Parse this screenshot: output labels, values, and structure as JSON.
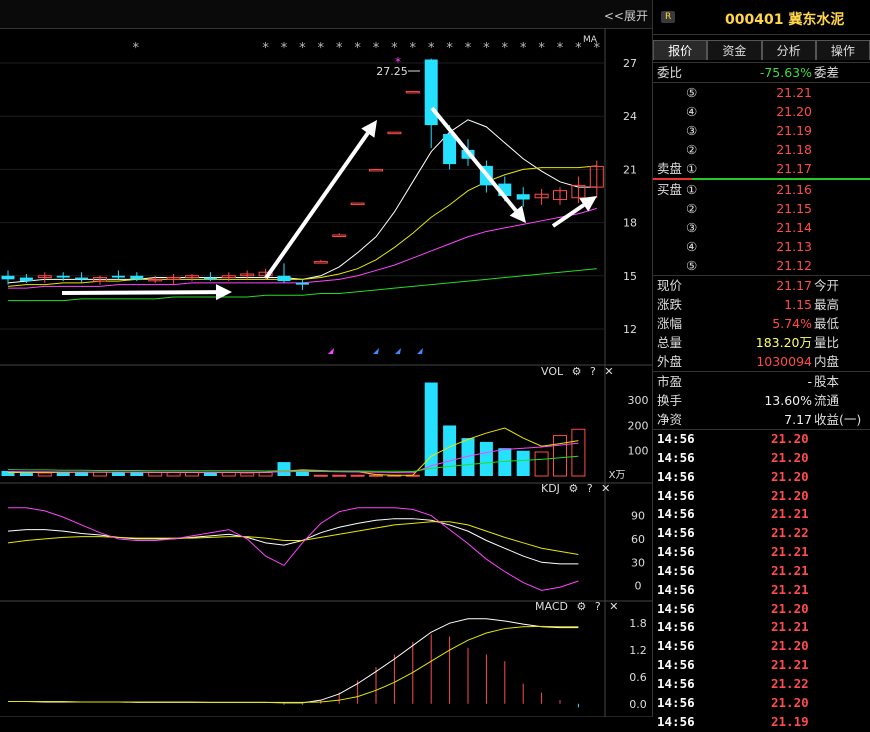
{
  "topbar": {
    "expand_label": "<<展开"
  },
  "chart_data": [
    {
      "type": "candlestick",
      "title": "MA",
      "yticks": [
        27,
        24,
        21,
        18,
        15,
        12
      ],
      "ylim": [
        10.7,
        28.3
      ],
      "peak_label": "27.25",
      "candles": [
        {
          "o": 15.0,
          "h": 15.3,
          "l": 14.5,
          "c": 14.8
        },
        {
          "o": 14.9,
          "h": 15.1,
          "l": 14.6,
          "c": 14.7
        },
        {
          "o": 14.9,
          "h": 15.2,
          "l": 14.6,
          "c": 15.0
        },
        {
          "o": 15.0,
          "h": 15.2,
          "l": 14.7,
          "c": 14.9
        },
        {
          "o": 14.9,
          "h": 15.2,
          "l": 14.6,
          "c": 14.8
        },
        {
          "o": 14.7,
          "h": 15.0,
          "l": 14.5,
          "c": 14.9
        },
        {
          "o": 15.0,
          "h": 15.3,
          "l": 14.8,
          "c": 14.9
        },
        {
          "o": 15.0,
          "h": 15.2,
          "l": 14.7,
          "c": 14.8
        },
        {
          "o": 14.8,
          "h": 15.0,
          "l": 14.6,
          "c": 14.8
        },
        {
          "o": 14.8,
          "h": 15.1,
          "l": 14.5,
          "c": 14.9
        },
        {
          "o": 14.9,
          "h": 15.1,
          "l": 14.7,
          "c": 15.0
        },
        {
          "o": 14.9,
          "h": 15.2,
          "l": 14.7,
          "c": 14.8
        },
        {
          "o": 14.9,
          "h": 15.2,
          "l": 14.7,
          "c": 15.0
        },
        {
          "o": 15.0,
          "h": 15.3,
          "l": 14.8,
          "c": 15.1
        },
        {
          "o": 15.0,
          "h": 15.4,
          "l": 14.8,
          "c": 15.2
        },
        {
          "o": 15.0,
          "h": 15.7,
          "l": 14.6,
          "c": 14.7
        },
        {
          "o": 14.6,
          "h": 14.8,
          "l": 14.2,
          "c": 14.5
        },
        {
          "o": 15.8,
          "h": 15.9,
          "l": 15.8,
          "c": 15.8
        },
        {
          "o": 17.3,
          "h": 17.4,
          "l": 17.3,
          "c": 17.3
        },
        {
          "o": 19.1,
          "h": 19.1,
          "l": 19.1,
          "c": 19.1
        },
        {
          "o": 21.0,
          "h": 21.0,
          "l": 21.0,
          "c": 21.0
        },
        {
          "o": 23.1,
          "h": 23.1,
          "l": 23.1,
          "c": 23.1
        },
        {
          "o": 25.4,
          "h": 25.4,
          "l": 25.4,
          "c": 25.4
        },
        {
          "o": 27.2,
          "h": 27.25,
          "l": 22.2,
          "c": 23.5
        },
        {
          "o": 23.0,
          "h": 23.5,
          "l": 21.0,
          "c": 21.3
        },
        {
          "o": 22.1,
          "h": 22.7,
          "l": 21.2,
          "c": 21.6
        },
        {
          "o": 21.2,
          "h": 21.5,
          "l": 19.7,
          "c": 20.1
        },
        {
          "o": 20.2,
          "h": 20.6,
          "l": 19.2,
          "c": 19.5
        },
        {
          "o": 19.6,
          "h": 20.0,
          "l": 18.9,
          "c": 19.3
        },
        {
          "o": 19.4,
          "h": 19.9,
          "l": 19.0,
          "c": 19.6
        },
        {
          "o": 19.3,
          "h": 20.0,
          "l": 19.0,
          "c": 19.8
        },
        {
          "o": 19.4,
          "h": 20.6,
          "l": 19.1,
          "c": 20.1
        },
        {
          "o": 20.0,
          "h": 21.5,
          "l": 19.4,
          "c": 21.17
        }
      ],
      "ma": [
        {
          "name": "MA5",
          "color": "#ffffff",
          "values": [
            14.6,
            14.7,
            14.8,
            14.8,
            14.8,
            14.8,
            14.8,
            14.8,
            14.9,
            14.9,
            14.9,
            14.9,
            14.9,
            14.9,
            14.9,
            14.9,
            14.8,
            15.0,
            15.5,
            16.3,
            17.2,
            18.6,
            20.3,
            22.0,
            23.1,
            23.8,
            23.4,
            22.5,
            21.6,
            20.9,
            20.3,
            20.0,
            20.0
          ]
        },
        {
          "name": "MA10",
          "color": "#e6e600",
          "values": [
            14.4,
            14.5,
            14.5,
            14.6,
            14.6,
            14.7,
            14.7,
            14.8,
            14.8,
            14.8,
            14.8,
            14.8,
            14.8,
            14.8,
            14.8,
            14.8,
            14.8,
            14.9,
            15.1,
            15.4,
            15.9,
            16.6,
            17.4,
            18.3,
            19.0,
            19.8,
            20.3,
            20.7,
            21.0,
            21.1,
            21.1,
            21.1,
            21.2
          ]
        },
        {
          "name": "MA20",
          "color": "#ff44ff",
          "values": [
            14.3,
            14.3,
            14.4,
            14.4,
            14.4,
            14.4,
            14.5,
            14.5,
            14.5,
            14.5,
            14.6,
            14.6,
            14.6,
            14.6,
            14.6,
            14.6,
            14.6,
            14.7,
            14.8,
            15.0,
            15.3,
            15.6,
            16.0,
            16.4,
            16.8,
            17.2,
            17.5,
            17.7,
            17.9,
            18.1,
            18.3,
            18.5,
            18.8
          ]
        },
        {
          "name": "MA60",
          "color": "#22dd22",
          "values": [
            13.6,
            13.6,
            13.6,
            13.6,
            13.7,
            13.7,
            13.7,
            13.7,
            13.7,
            13.8,
            13.8,
            13.8,
            13.8,
            13.8,
            13.9,
            13.9,
            13.9,
            14.0,
            14.0,
            14.1,
            14.2,
            14.3,
            14.4,
            14.5,
            14.6,
            14.7,
            14.8,
            14.9,
            15.0,
            15.1,
            15.2,
            15.3,
            15.4
          ]
        }
      ]
    },
    {
      "type": "bar",
      "title": "VOL",
      "unit": "X万",
      "yticks": [
        300,
        200,
        100
      ],
      "ylim": [
        0,
        380
      ],
      "values": [
        20,
        14,
        12,
        14,
        16,
        16,
        14,
        14,
        14,
        14,
        14,
        16,
        14,
        12,
        14,
        55,
        22,
        3,
        3,
        3,
        3,
        3,
        3,
        370,
        200,
        150,
        135,
        110,
        100,
        95,
        160,
        185
      ],
      "ma": [
        {
          "name": "MA5",
          "color": "#e6e600",
          "values": [
            14,
            14,
            14,
            14,
            15,
            15,
            15,
            15,
            14,
            14,
            14,
            14,
            14,
            14,
            14,
            20,
            24,
            22,
            18,
            17,
            6,
            3,
            3,
            78,
            115,
            145,
            170,
            190,
            150,
            118,
            128,
            140
          ]
        },
        {
          "name": "MA10",
          "color": "#ff44ff",
          "values": [
            18,
            17,
            17,
            16,
            16,
            16,
            16,
            16,
            15,
            15,
            15,
            15,
            15,
            15,
            15,
            17,
            18,
            18,
            17,
            16,
            15,
            14,
            13,
            40,
            60,
            78,
            93,
            105,
            110,
            115,
            122,
            130
          ]
        },
        {
          "name": "MA20",
          "color": "#22dd22",
          "values": [
            25,
            24,
            24,
            23,
            23,
            22,
            22,
            22,
            21,
            21,
            21,
            21,
            21,
            21,
            20,
            21,
            21,
            21,
            20,
            20,
            19,
            19,
            18,
            30,
            38,
            45,
            52,
            58,
            62,
            66,
            72,
            78
          ]
        }
      ]
    },
    {
      "type": "line",
      "title": "KDJ",
      "yticks": [
        90,
        60,
        30,
        0
      ],
      "ylim": [
        -12,
        110
      ],
      "series": [
        {
          "name": "K",
          "color": "#ffffff",
          "values": [
            70,
            72,
            72,
            70,
            67,
            65,
            62,
            60,
            60,
            60,
            62,
            64,
            66,
            62,
            55,
            52,
            58,
            68,
            75,
            80,
            84,
            86,
            86,
            84,
            78,
            70,
            58,
            48,
            38,
            30,
            28,
            28
          ]
        },
        {
          "name": "D",
          "color": "#e6e600",
          "values": [
            55,
            58,
            60,
            62,
            63,
            63,
            62,
            61,
            61,
            61,
            61,
            62,
            63,
            63,
            61,
            58,
            58,
            62,
            66,
            70,
            74,
            78,
            80,
            82,
            82,
            78,
            70,
            62,
            55,
            48,
            44,
            40
          ]
        },
        {
          "name": "J",
          "color": "#ff44ff",
          "values": [
            100,
            100,
            96,
            88,
            78,
            68,
            60,
            58,
            58,
            60,
            64,
            68,
            72,
            60,
            38,
            26,
            55,
            80,
            95,
            100,
            100,
            100,
            98,
            90,
            72,
            54,
            34,
            18,
            4,
            -6,
            -2,
            6
          ]
        }
      ]
    },
    {
      "type": "bar",
      "title": "MACD",
      "yticks": [
        1.8,
        1.2,
        0.6,
        0.0
      ],
      "ylim": [
        -0.05,
        2.05
      ],
      "histogram": [
        0,
        0,
        0,
        0,
        0,
        0,
        0,
        0,
        0,
        0,
        0,
        0,
        0,
        0,
        0,
        -0.02,
        -0.02,
        0.08,
        0.25,
        0.52,
        0.82,
        1.1,
        1.38,
        1.55,
        1.5,
        1.25,
        1.1,
        0.95,
        0.45,
        0.25,
        0.08,
        -0.08
      ],
      "series": [
        {
          "name": "DIF",
          "color": "#ffffff",
          "values": [
            0.05,
            0.05,
            0.04,
            0.04,
            0.04,
            0.04,
            0.04,
            0.03,
            0.03,
            0.03,
            0.03,
            0.03,
            0.03,
            0.03,
            0.03,
            0.02,
            0.02,
            0.08,
            0.22,
            0.45,
            0.72,
            1.0,
            1.3,
            1.6,
            1.8,
            1.9,
            1.9,
            1.85,
            1.78,
            1.72,
            1.7,
            1.7
          ]
        },
        {
          "name": "DEA",
          "color": "#e6e600",
          "values": [
            0.05,
            0.05,
            0.05,
            0.05,
            0.04,
            0.04,
            0.04,
            0.04,
            0.04,
            0.04,
            0.04,
            0.03,
            0.03,
            0.03,
            0.03,
            0.03,
            0.03,
            0.04,
            0.08,
            0.16,
            0.3,
            0.48,
            0.7,
            0.95,
            1.2,
            1.42,
            1.58,
            1.68,
            1.72,
            1.73,
            1.72,
            1.72
          ]
        }
      ]
    }
  ],
  "panels": {
    "vol": {
      "title": "VOL",
      "gear": "⚙",
      "help": "?",
      "close": "✕"
    },
    "kdj": {
      "title": "KDJ",
      "gear": "⚙",
      "help": "?",
      "close": "✕"
    },
    "macd": {
      "title": "MACD",
      "gear": "⚙",
      "help": "?",
      "close": "✕"
    }
  },
  "stock": {
    "badge": "R",
    "title": "000401  冀东水泥"
  },
  "tabs": [
    "报价",
    "资金",
    "分析",
    "操作"
  ],
  "weibi": {
    "label": "委比",
    "value": "-75.63%",
    "right": "委差"
  },
  "asks": [
    {
      "idx": "⑤",
      "price": "21.21"
    },
    {
      "idx": "④",
      "price": "21.20"
    },
    {
      "idx": "③",
      "price": "21.19"
    },
    {
      "idx": "②",
      "price": "21.18"
    },
    {
      "label": "卖盘",
      "idx": "①",
      "price": "21.17"
    }
  ],
  "bids": [
    {
      "label": "买盘",
      "idx": "①",
      "price": "21.16"
    },
    {
      "idx": "②",
      "price": "21.15"
    },
    {
      "idx": "③",
      "price": "21.14"
    },
    {
      "idx": "④",
      "price": "21.13"
    },
    {
      "idx": "⑤",
      "price": "21.12"
    }
  ],
  "quote": [
    {
      "l": "现价",
      "v": "21.17",
      "r": "今开",
      "c": "red"
    },
    {
      "l": "涨跌",
      "v": "1.15",
      "r": "最高",
      "c": "red"
    },
    {
      "l": "涨幅",
      "v": "5.74%",
      "r": "最低",
      "c": "red"
    },
    {
      "l": "总量",
      "v": "183.20万",
      "r": "量比",
      "c": "yellow"
    },
    {
      "l": "外盘",
      "v": "1030094",
      "r": "内盘",
      "c": "red"
    }
  ],
  "fund": [
    {
      "l": "市盈",
      "v": "-",
      "r": "股本"
    },
    {
      "l": "换手",
      "v": "13.60%",
      "r": "流通"
    },
    {
      "l": "净资",
      "v": "7.17",
      "r": "收益(一)"
    }
  ],
  "ticks": [
    {
      "t": "14:56",
      "p": "21.20"
    },
    {
      "t": "14:56",
      "p": "21.20"
    },
    {
      "t": "14:56",
      "p": "21.20"
    },
    {
      "t": "14:56",
      "p": "21.20"
    },
    {
      "t": "14:56",
      "p": "21.21"
    },
    {
      "t": "14:56",
      "p": "21.22"
    },
    {
      "t": "14:56",
      "p": "21.21"
    },
    {
      "t": "14:56",
      "p": "21.21"
    },
    {
      "t": "14:56",
      "p": "21.21"
    },
    {
      "t": "14:56",
      "p": "21.20"
    },
    {
      "t": "14:56",
      "p": "21.21"
    },
    {
      "t": "14:56",
      "p": "21.20"
    },
    {
      "t": "14:56",
      "p": "21.21"
    },
    {
      "t": "14:56",
      "p": "21.22"
    },
    {
      "t": "14:56",
      "p": "21.20"
    },
    {
      "t": "14:56",
      "p": "21.19"
    }
  ]
}
